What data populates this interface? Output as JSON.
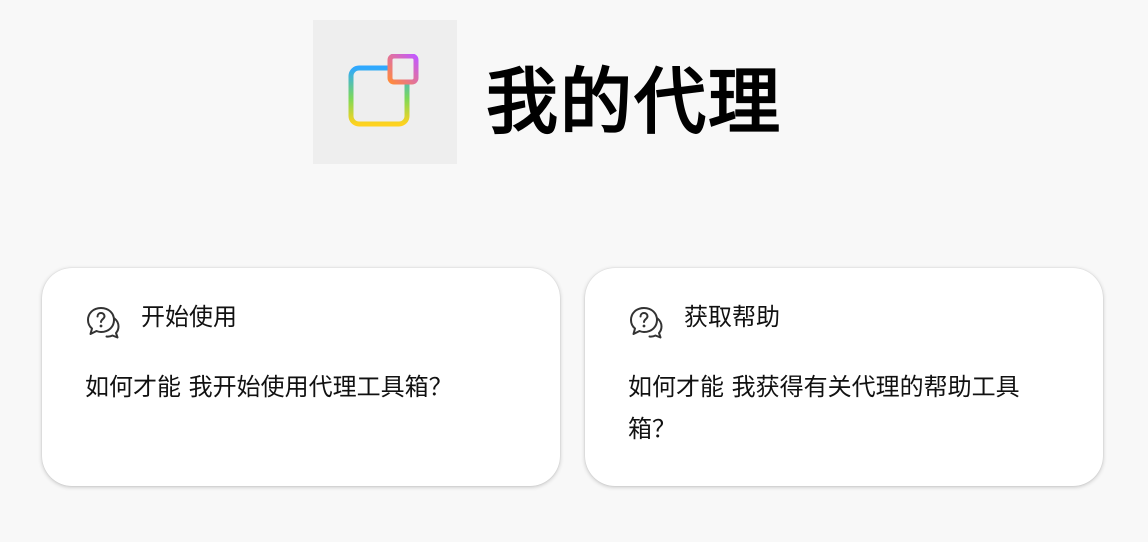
{
  "header": {
    "title": "我的代理",
    "app_icon": "agent-apps-icon"
  },
  "cards": [
    {
      "icon": "help-chat-icon",
      "heading": "开始使用",
      "body": "如何才能 我开始使用代理工具箱？"
    },
    {
      "icon": "help-chat-icon",
      "heading": "获取帮助",
      "body": "如何才能 我获得有关代理的帮助工具箱？"
    }
  ],
  "colors": {
    "background": "#f8f8f8",
    "icon_tile": "#eeeeee",
    "card": "#ffffff",
    "icon_gradient": [
      "#2fa8ff",
      "#7ed957",
      "#ffd21f",
      "#ff8a3d",
      "#c259ff"
    ]
  }
}
